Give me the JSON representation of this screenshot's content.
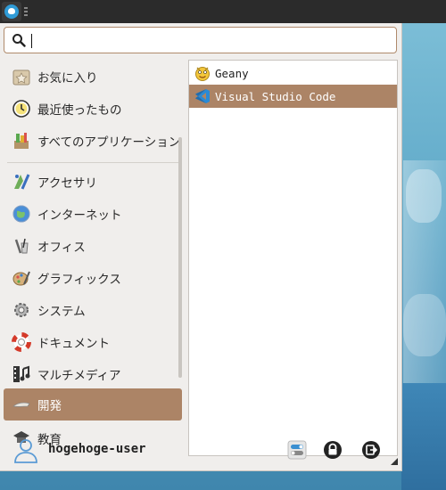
{
  "search": {
    "value": "",
    "placeholder": ""
  },
  "categories": [
    {
      "label": "お気に入り",
      "icon": "favorites-icon"
    },
    {
      "label": "最近使ったもの",
      "icon": "recent-icon"
    },
    {
      "label": "すべてのアプリケーション",
      "icon": "all-applications-icon"
    },
    {
      "label": "アクセサリ",
      "icon": "accessories-icon"
    },
    {
      "label": "インターネット",
      "icon": "internet-icon"
    },
    {
      "label": "オフィス",
      "icon": "office-icon"
    },
    {
      "label": "グラフィックス",
      "icon": "graphics-icon"
    },
    {
      "label": "システム",
      "icon": "system-icon"
    },
    {
      "label": "ドキュメント",
      "icon": "documentation-icon"
    },
    {
      "label": "マルチメディア",
      "icon": "multimedia-icon"
    },
    {
      "label": "開発",
      "icon": "development-icon",
      "selected": true
    },
    {
      "label": "教育",
      "icon": "education-icon"
    }
  ],
  "apps": [
    {
      "label": "Geany",
      "icon": "geany-icon"
    },
    {
      "label": "Visual Studio Code",
      "icon": "vscode-icon",
      "selected": true
    }
  ],
  "footer": {
    "username": "hogehoge-user",
    "actions": [
      "settings-icon",
      "lock-icon",
      "logout-icon"
    ]
  },
  "colors": {
    "selection": "#ac8466",
    "panel": "#2b2b2b",
    "menu_bg": "#f0eeec"
  }
}
